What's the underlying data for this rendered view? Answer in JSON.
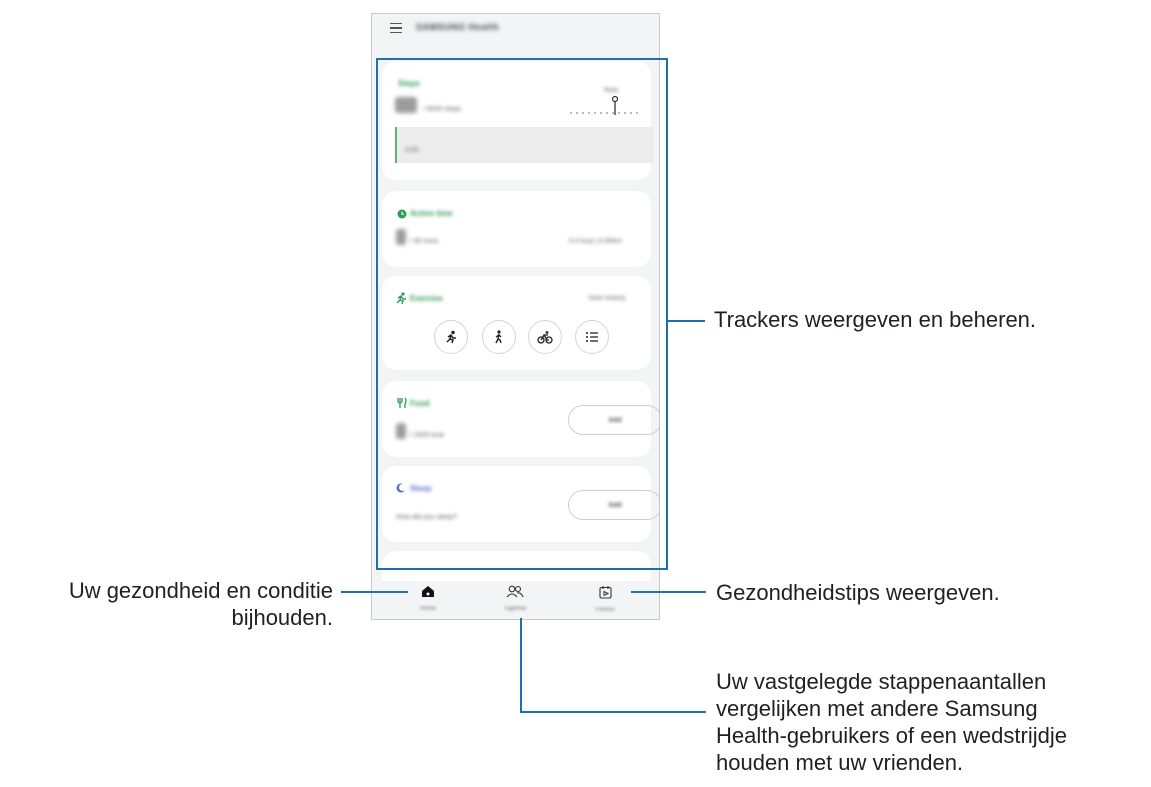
{
  "app": {
    "title": "SAMSUNG Health",
    "menu_icon": "menu-icon"
  },
  "cards": {
    "steps": {
      "title": "Steps",
      "target_suffix": "/ 6000 steps",
      "marker_label": "Now",
      "chart_label": "0:00"
    },
    "active_time": {
      "title": "Active time",
      "target_suffix": "/ 90 mins",
      "stats": "0.0 kcal  |  0.00km"
    },
    "exercise": {
      "title": "Exercise",
      "view_history": "View history",
      "buttons": [
        "running-icon",
        "walking-icon",
        "cycling-icon",
        "list-icon"
      ]
    },
    "food": {
      "title": "Food",
      "target_suffix": "/ 2000 kcal",
      "add_label": "Add"
    },
    "sleep": {
      "title": "Sleep",
      "prompt": "How did you sleep?",
      "add_label": "Add"
    }
  },
  "nav": [
    {
      "label": "Home",
      "icon": "home-icon"
    },
    {
      "label": "Together",
      "icon": "together-icon"
    },
    {
      "label": "Fitness",
      "icon": "fitness-icon"
    }
  ],
  "callouts": {
    "trackers": "Trackers weergeven en beheren.",
    "home_line1": "Uw gezondheid en conditie",
    "home_line2": "bijhouden.",
    "fitness": "Gezondheidstips weergeven.",
    "together_line1": "Uw vastgelegde stappenaantallen",
    "together_line2": "vergelijken met andere Samsung",
    "together_line3": "Health-gebruikers of een wedstrijdje",
    "together_line4": "houden met uw vrienden."
  },
  "colors": {
    "accent_line": "#1f6fa8",
    "green": "#2e9a57",
    "sleep_blue": "#5a6fd6"
  }
}
